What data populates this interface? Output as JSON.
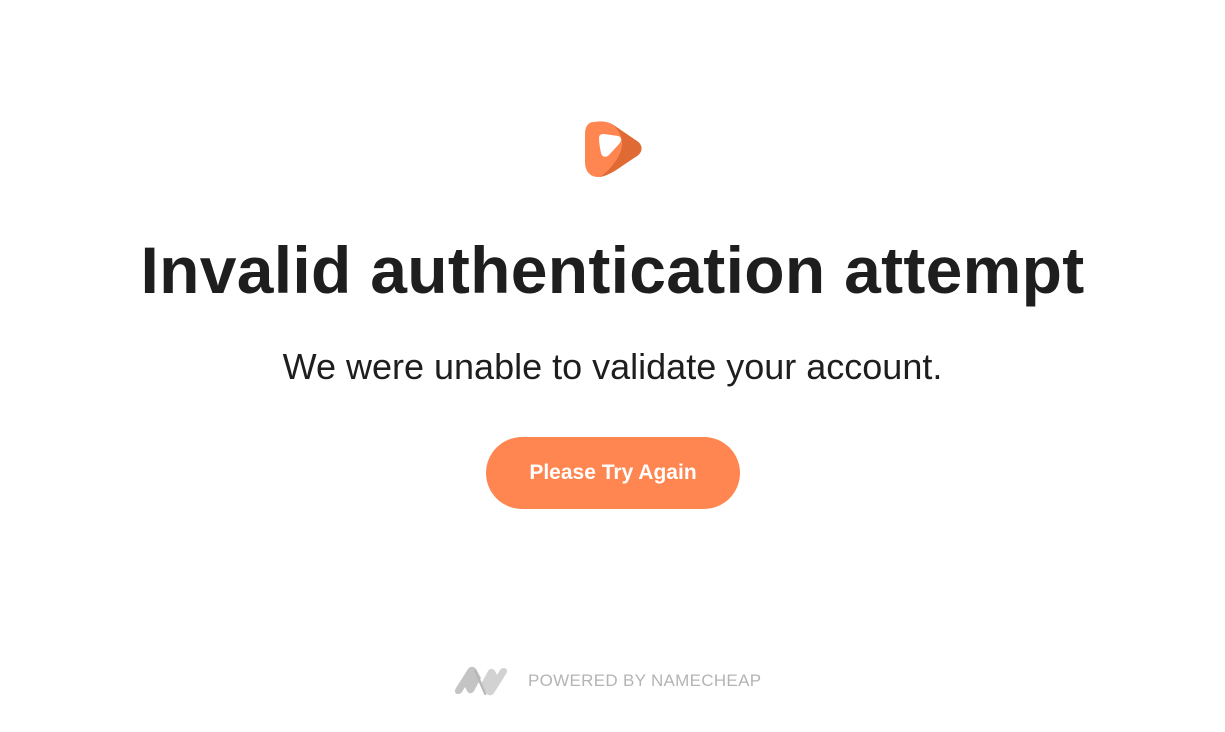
{
  "brand": {
    "logo_icon": "orange-shield-logo-icon",
    "accent_color": "#ff8651",
    "accent_dark": "#e06a33"
  },
  "main": {
    "heading": "Invalid authentication attempt",
    "message": "We were unable to validate your account.",
    "retry_button_label": "Please Try Again"
  },
  "footer": {
    "logo_icon": "namecheap-n-icon",
    "powered_by": "POWERED BY NAMECHEAP",
    "text_color": "#b4b4b4"
  }
}
